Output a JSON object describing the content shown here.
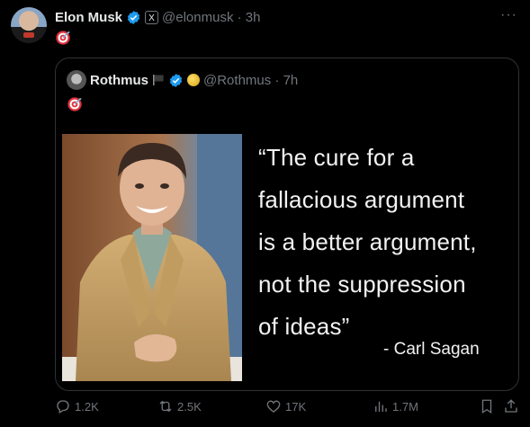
{
  "post": {
    "author_name": "Elon Musk",
    "handle_time": "@elonmusk · 3h",
    "badge_x": "X",
    "more": "···",
    "body_emoji": "🎯"
  },
  "quoted": {
    "author_name": "Rothmus",
    "handle_time": "@Rothmus · 7h",
    "body_emoji": "🎯",
    "image": {
      "quote_lines": [
        "“The cure for a",
        "fallacious argument",
        "is a better argument,",
        "not the suppression",
        "of ideas”"
      ],
      "attribution": "- Carl Sagan"
    }
  },
  "actions": {
    "replies": "1.2K",
    "reposts": "2.5K",
    "likes": "17K",
    "views": "1.7M"
  },
  "colors": {
    "background": "#000000",
    "text": "#e7e9ea",
    "muted": "#71767b",
    "verified": "#1d9bf0",
    "border": "#2f3336"
  }
}
